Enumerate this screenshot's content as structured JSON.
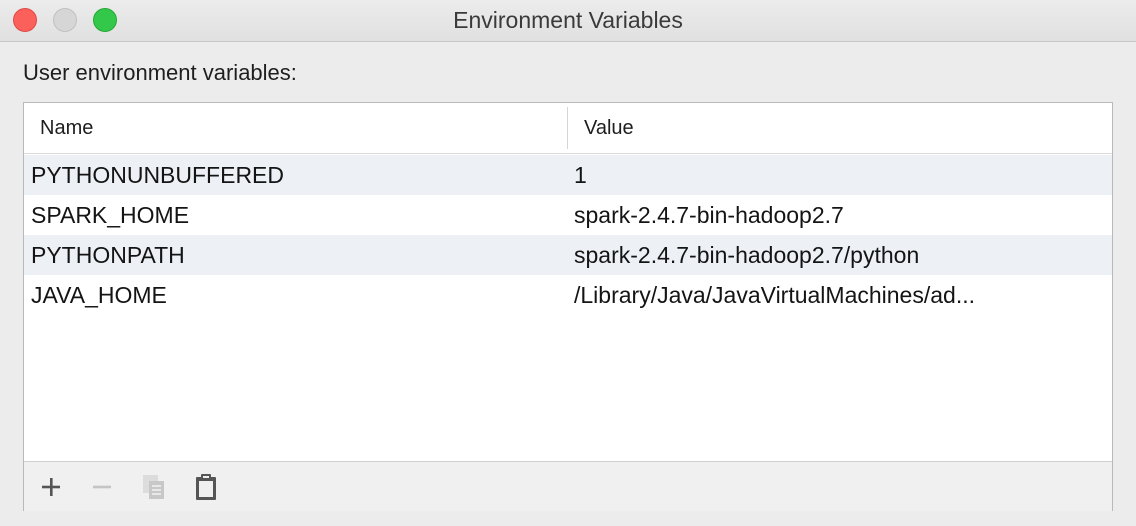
{
  "window": {
    "title": "Environment Variables"
  },
  "section": {
    "label": "User environment variables:"
  },
  "table": {
    "columns": {
      "name": "Name",
      "value": "Value"
    },
    "rows": [
      {
        "name": "PYTHONUNBUFFERED",
        "value": "1"
      },
      {
        "name": "SPARK_HOME",
        "value": "spark-2.4.7-bin-hadoop2.7"
      },
      {
        "name": "PYTHONPATH",
        "value": "spark-2.4.7-bin-hadoop2.7/python"
      },
      {
        "name": "JAVA_HOME",
        "value": "/Library/Java/JavaVirtualMachines/ad..."
      }
    ]
  },
  "toolbar": {
    "icons": [
      "plus-icon",
      "minus-icon",
      "copy-icon",
      "clipboard-icon"
    ]
  },
  "colors": {
    "close": "#fc605b",
    "zoom": "#34c84a",
    "row_alt": "#edf1f6"
  }
}
